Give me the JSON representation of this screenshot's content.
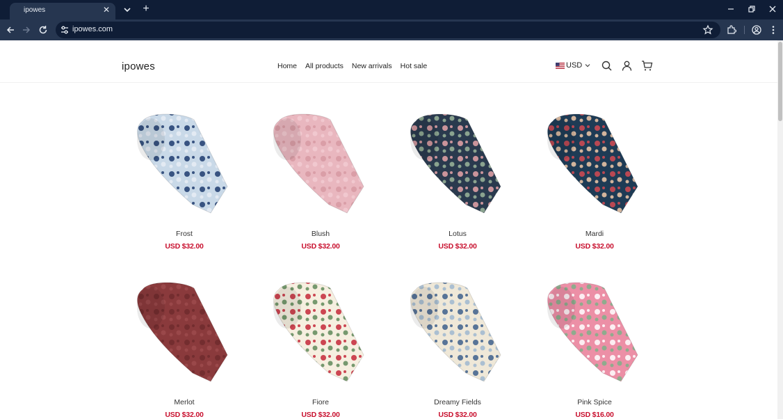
{
  "browser": {
    "tab_title": "ipowes",
    "url": "ipowes.com"
  },
  "site": {
    "logo": "ipowes",
    "nav": [
      "Home",
      "All products",
      "New arrivals",
      "Hot sale"
    ],
    "currency": "USD"
  },
  "colors": {
    "price": "#c8102e",
    "chrome_dark": "#0f1d36",
    "chrome_bar": "#263650"
  },
  "products": [
    {
      "name": "Frost",
      "price": "USD $32.00",
      "base": "#c9d9e8",
      "accent": "#1e3c6e",
      "accent2": "#e8eef5"
    },
    {
      "name": "Blush",
      "price": "USD $32.00",
      "base": "#e9b7bf",
      "accent": "#d79aa4",
      "accent2": "#f2ccd2"
    },
    {
      "name": "Lotus",
      "price": "USD $32.00",
      "base": "#2a3a4e",
      "accent": "#e6a3a8",
      "accent2": "#9bb59a"
    },
    {
      "name": "Mardi",
      "price": "USD $32.00",
      "base": "#1e3b55",
      "accent": "#d54a52",
      "accent2": "#f2c9a8"
    },
    {
      "name": "Merlot",
      "price": "USD $32.00",
      "base": "#8a3a3c",
      "accent": "#6f2a2d",
      "accent2": "#9c4a4c"
    },
    {
      "name": "Fiore",
      "price": "USD $32.00",
      "base": "#f6efe0",
      "accent": "#c4283a",
      "accent2": "#5f8a5a"
    },
    {
      "name": "Dreamy Fields",
      "price": "USD $32.00",
      "base": "#efe8d8",
      "accent": "#3d5f8c",
      "accent2": "#9fb8d0"
    },
    {
      "name": "Pink Spice",
      "price": "USD $16.00",
      "base": "#ec8fa6",
      "accent": "#ffffff",
      "accent2": "#7fb088"
    }
  ]
}
